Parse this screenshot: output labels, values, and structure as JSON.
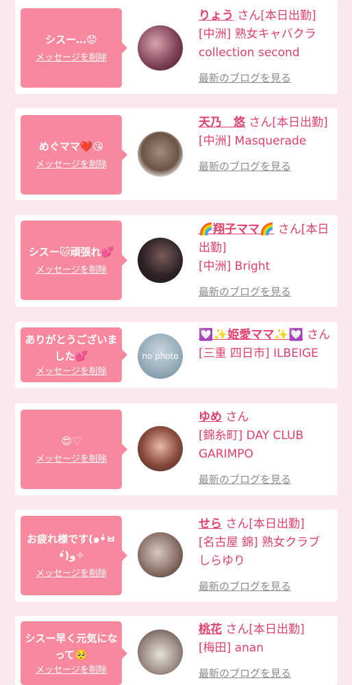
{
  "delete_label": "メッセージを削除",
  "blog_label": "最新のブログを見る",
  "entries": [
    {
      "message": "シスー…😟",
      "name": "りょう",
      "suffix": " さん[本日出勤]",
      "shop": "[中洲] 熟女キャバクラ collection second",
      "blog": "最新のブログを見る"
    },
    {
      "message": "めぐママ❤️😘",
      "name": "天乃　悠",
      "suffix": " さん[本日出勤]",
      "shop": "[中洲] Masquerade",
      "blog": "最新のブログを見る"
    },
    {
      "message": "シスー🐱頑張れ💕",
      "name": "🌈翔子ママ🌈",
      "suffix": " さん[本日出勤]",
      "shop": "[中洲] Bright",
      "blog": "最新のブログを見る"
    },
    {
      "message": "ありがとうございました💕",
      "name": "💟✨姫愛ママ✨💟",
      "suffix": " さん",
      "shop": "[三重 四日市] ILBEIGE",
      "blog": "",
      "avatar_text": "no photo"
    },
    {
      "message": "😍♡",
      "name": "ゆめ",
      "suffix": " さん",
      "shop": "[錦糸町] DAY CLUB GARIMPO",
      "blog": "最新のブログを見る"
    },
    {
      "message": "お疲れ様です(๑•̀ㅂ•́)و✧",
      "name": "せら",
      "suffix": " さん[本日出勤]",
      "shop": "[名古屋 錦] 熟女クラブ しらゆり",
      "blog": "最新のブログを見る"
    },
    {
      "message": "シスー早く元気になって🥺",
      "name": "桃花",
      "suffix": " さん[本日出勤]",
      "shop": "[梅田] anan",
      "blog": "最新のブログを見る"
    }
  ]
}
